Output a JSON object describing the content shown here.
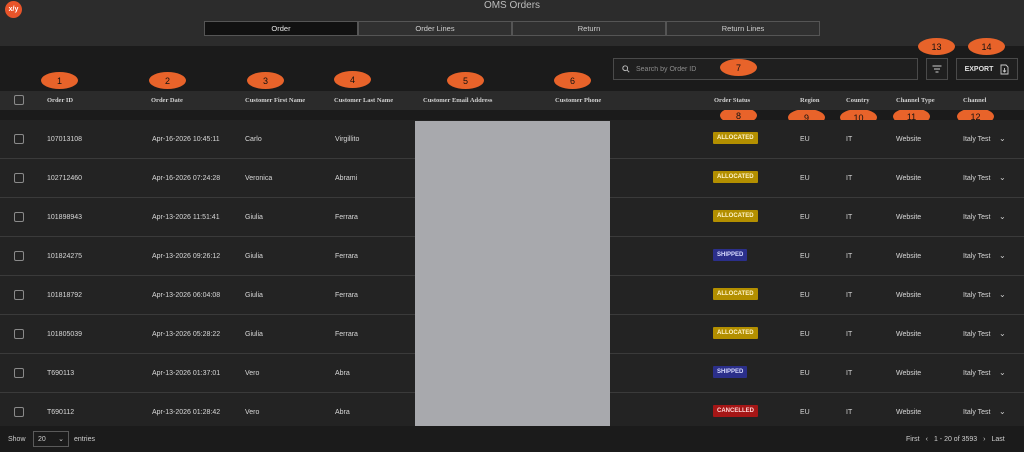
{
  "app": {
    "logo_text": "x/y",
    "title": "OMS Orders"
  },
  "tabs": [
    {
      "label": "Order",
      "active": true
    },
    {
      "label": "Order Lines",
      "active": false
    },
    {
      "label": "Return",
      "active": false
    },
    {
      "label": "Return Lines",
      "active": false
    }
  ],
  "toolbar": {
    "search_placeholder": "Search by Order ID",
    "export_label": "EXPORT"
  },
  "annotations": [
    "1",
    "2",
    "3",
    "4",
    "5",
    "6",
    "7",
    "8",
    "9",
    "10",
    "11",
    "12",
    "13",
    "14"
  ],
  "columns": {
    "order_id": "Order ID",
    "order_date": "Order Date",
    "first_name": "Customer First Name",
    "last_name": "Customer Last Name",
    "email": "Customer Email Address",
    "phone": "Customer Phone",
    "status": "Order Status",
    "region": "Region",
    "country": "Country",
    "channel_type": "Channel Type",
    "channel": "Channel"
  },
  "rows": [
    {
      "order_id": "107013108",
      "date": "Apr-16-2026 10:45:11",
      "first": "Carlo",
      "last": "Virgillito",
      "status": "ALLOCATED",
      "region": "EU",
      "country": "IT",
      "channel_type": "Website",
      "channel": "Italy Test"
    },
    {
      "order_id": "102712460",
      "date": "Apr-16-2026 07:24:28",
      "first": "Veronica",
      "last": "Abrami",
      "status": "ALLOCATED",
      "region": "EU",
      "country": "IT",
      "channel_type": "Website",
      "channel": "Italy Test"
    },
    {
      "order_id": "101898943",
      "date": "Apr-13-2026 11:51:41",
      "first": "Giulia",
      "last": "Ferrara",
      "status": "ALLOCATED",
      "region": "EU",
      "country": "IT",
      "channel_type": "Website",
      "channel": "Italy Test"
    },
    {
      "order_id": "101824275",
      "date": "Apr-13-2026 09:26:12",
      "first": "Giulia",
      "last": "Ferrara",
      "status": "SHIPPED",
      "region": "EU",
      "country": "IT",
      "channel_type": "Website",
      "channel": "Italy Test"
    },
    {
      "order_id": "101818792",
      "date": "Apr-13-2026 06:04:08",
      "first": "Giulia",
      "last": "Ferrara",
      "status": "ALLOCATED",
      "region": "EU",
      "country": "IT",
      "channel_type": "Website",
      "channel": "Italy Test"
    },
    {
      "order_id": "101805039",
      "date": "Apr-13-2026 05:28:22",
      "first": "Giulia",
      "last": "Ferrara",
      "status": "ALLOCATED",
      "region": "EU",
      "country": "IT",
      "channel_type": "Website",
      "channel": "Italy Test"
    },
    {
      "order_id": "T690113",
      "date": "Apr-13-2026 01:37:01",
      "first": "Vero",
      "last": "Abra",
      "status": "SHIPPED",
      "region": "EU",
      "country": "IT",
      "channel_type": "Website",
      "channel": "Italy Test"
    },
    {
      "order_id": "T690112",
      "date": "Apr-13-2026 01:28:42",
      "first": "Vero",
      "last": "Abra",
      "status": "CANCELLED",
      "region": "EU",
      "country": "IT",
      "channel_type": "Website",
      "channel": "Italy Test"
    }
  ],
  "footer": {
    "show_label": "Show",
    "page_size": "20",
    "entries_label": "entries",
    "first_label": "First",
    "range_label": "1 - 20 of 3593",
    "last_label": "Last"
  },
  "colors": {
    "accent": "#e8632a",
    "allocated": "#b38f00",
    "shipped": "#2b2f8a",
    "cancelled": "#a51616"
  }
}
